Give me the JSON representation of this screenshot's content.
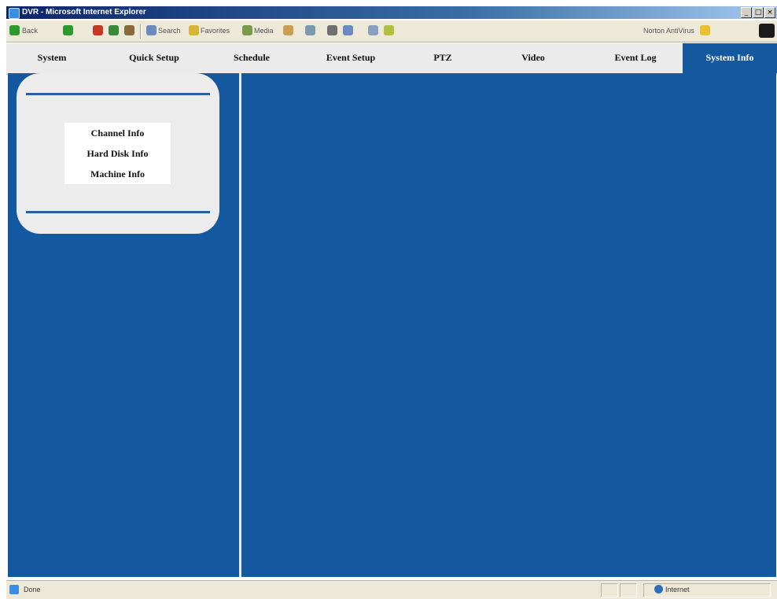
{
  "window": {
    "title": "DVR - Microsoft Internet Explorer",
    "buttons": [
      "_",
      "□",
      "×"
    ]
  },
  "toolbar": {
    "back": "Back",
    "search": "Search",
    "favorites": "Favorites",
    "media": "Media",
    "antivirus": "Norton AntiVirus"
  },
  "nav": {
    "tabs": [
      {
        "label": "System"
      },
      {
        "label": "Quick Setup"
      },
      {
        "label": "Schedule"
      },
      {
        "label": "Event Setup"
      },
      {
        "label": "PTZ"
      },
      {
        "label": "Video"
      },
      {
        "label": "Event Log"
      },
      {
        "label": "System Info"
      }
    ],
    "active": "System Info"
  },
  "sidebar": {
    "items": [
      {
        "label": "Channel Info"
      },
      {
        "label": "Hard Disk Info"
      },
      {
        "label": "Machine Info"
      }
    ]
  },
  "status": {
    "text": "Done",
    "zone": "Internet"
  },
  "colors": {
    "accent": "#1458a0",
    "panel": "#ececec"
  }
}
